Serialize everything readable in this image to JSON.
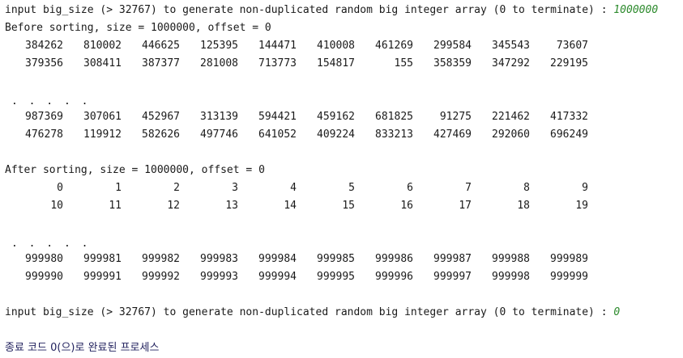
{
  "prompt_1": {
    "text": "input big_size (> 32767) to generate non-duplicated random big integer array (0 to terminate) : ",
    "input": "1000000"
  },
  "before": {
    "header": "Before sorting, size = 1000000, offset = 0",
    "rows": [
      [
        "384262",
        "810002",
        "446625",
        "125395",
        "144471",
        "410008",
        "461269",
        "299584",
        "345543",
        "73607"
      ],
      [
        "379356",
        "308411",
        "387377",
        "281008",
        "713773",
        "154817",
        "155",
        "358359",
        "347292",
        "229195"
      ]
    ],
    "ellipsis": ". . . . .",
    "rows_end": [
      [
        "987369",
        "307061",
        "452967",
        "313139",
        "594421",
        "459162",
        "681825",
        "91275",
        "221462",
        "417332"
      ],
      [
        "476278",
        "119912",
        "582626",
        "497746",
        "641052",
        "409224",
        "833213",
        "427469",
        "292060",
        "696249"
      ]
    ]
  },
  "after": {
    "header": "After sorting, size = 1000000, offset = 0",
    "rows": [
      [
        "0",
        "1",
        "2",
        "3",
        "4",
        "5",
        "6",
        "7",
        "8",
        "9"
      ],
      [
        "10",
        "11",
        "12",
        "13",
        "14",
        "15",
        "16",
        "17",
        "18",
        "19"
      ]
    ],
    "ellipsis": ". . . . .",
    "rows_end": [
      [
        "999980",
        "999981",
        "999982",
        "999983",
        "999984",
        "999985",
        "999986",
        "999987",
        "999988",
        "999989"
      ],
      [
        "999990",
        "999991",
        "999992",
        "999993",
        "999994",
        "999995",
        "999996",
        "999997",
        "999998",
        "999999"
      ]
    ]
  },
  "prompt_2": {
    "text": "input big_size (> 32767) to generate non-duplicated random big integer array (0 to terminate) : ",
    "input": "0"
  },
  "exit_message": "종료 코드 0(으)로 완료된 프로세스",
  "colors": {
    "input_value": "#2e8b2e",
    "exit_message": "#1f1f5c"
  }
}
